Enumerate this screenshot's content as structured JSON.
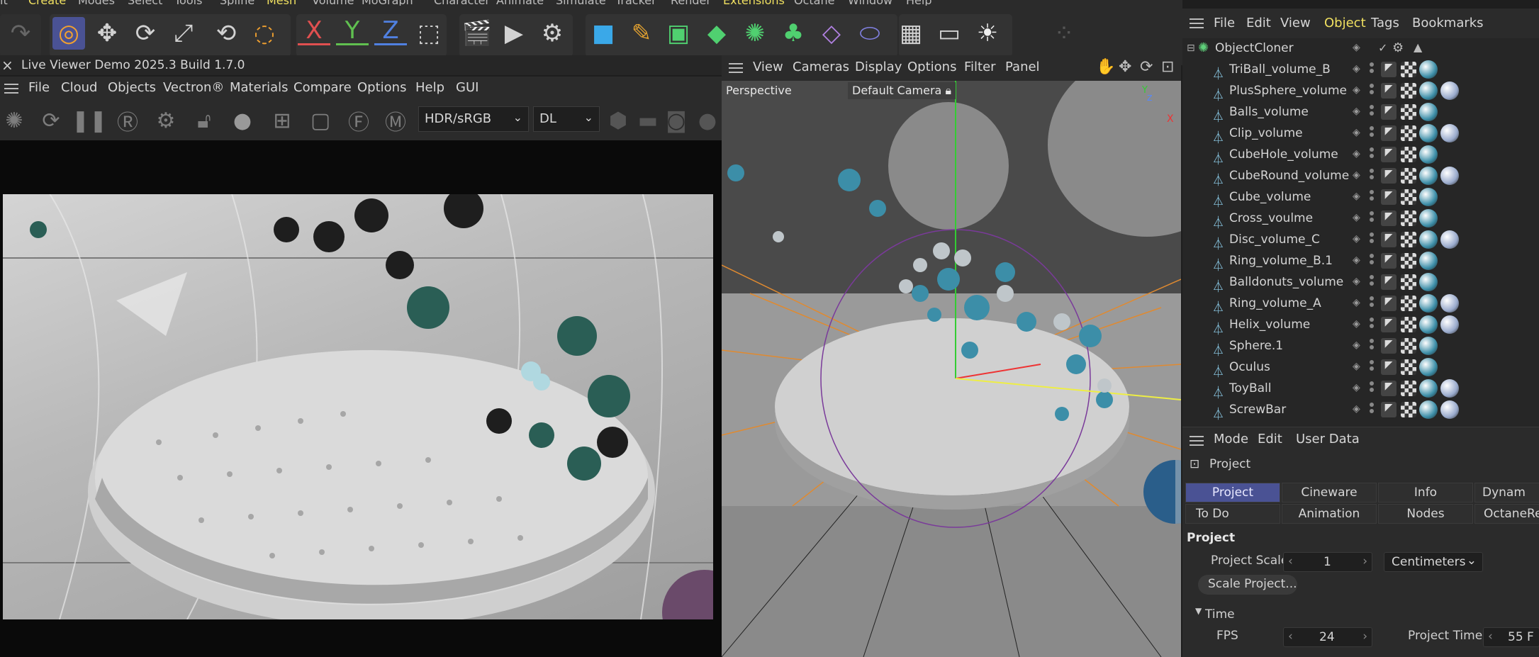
{
  "top_menu": [
    "it",
    "Create",
    "Modes",
    "Select",
    "Tools",
    "Spline",
    "Mesh",
    "Volume",
    "MoGraph",
    "Character",
    "Animate",
    "Simulate",
    "Tracker",
    "Render",
    "Extensions",
    "Octane",
    "Window",
    "Help"
  ],
  "toolbar": {
    "axis_x": "X",
    "axis_y": "Y",
    "axis_z": "Z",
    "icons": [
      "undo-icon",
      "live-selection-icon",
      "move-icon",
      "rotate-icon",
      "scale-icon",
      "last-tool-icon",
      "selection-filter-icon",
      "coordinate-system-icon",
      "clapper-icon",
      "render-view-icon",
      "render-settings-icon",
      "cube-icon",
      "pen-icon",
      "subdivision-icon",
      "extrude-icon",
      "cloner-icon",
      "mograph-icon",
      "deformer-icon",
      "field-icon",
      "grid-icon",
      "camera-icon",
      "light-icon",
      "dots-icon"
    ],
    "accent": "#4a5294"
  },
  "live_viewer": {
    "title": "Live Viewer Demo 2025.3 Build 1.7.0",
    "close_label": "×",
    "menu": [
      "File",
      "Cloud",
      "Objects",
      "Vectron®",
      "Materials",
      "Compare",
      "Options",
      "Help",
      "GUI"
    ],
    "color_space": "HDR/sRGB",
    "kernel": "DL",
    "icons": [
      "octane-icon",
      "restart-icon",
      "pause-icon",
      "region-icon",
      "settings-gear-icon",
      "lock-icon",
      "material-ball-icon",
      "add-icon",
      "frame-icon",
      "focus-icon",
      "marker-icon",
      "cube-small-icon",
      "flat-icon",
      "snapshot-icon",
      "sphere-small-icon"
    ]
  },
  "viewport": {
    "menu": [
      "View",
      "Cameras",
      "Display",
      "Options",
      "Filter",
      "Panel"
    ],
    "projection": "Perspective",
    "camera": "Default Camera",
    "axis_x": "X",
    "axis_y": "Y",
    "axis_z": "Z"
  },
  "object_manager": {
    "menu": [
      "File",
      "Edit",
      "View",
      "Object",
      "Tags",
      "Bookmarks"
    ],
    "active_menu": "Object",
    "root": "ObjectCloner",
    "items": [
      {
        "name": "TriBall_volume_B",
        "balls": 1
      },
      {
        "name": "PlusSphere_volume",
        "balls": 2
      },
      {
        "name": "Balls_volume",
        "balls": 1
      },
      {
        "name": "Clip_volume",
        "balls": 2
      },
      {
        "name": "CubeHole_volume",
        "balls": 1
      },
      {
        "name": "CubeRound_volume",
        "balls": 2
      },
      {
        "name": "Cube_volume",
        "balls": 1
      },
      {
        "name": "Cross_voulme",
        "balls": 1
      },
      {
        "name": "Disc_volume_C",
        "balls": 2
      },
      {
        "name": "Ring_volume_B.1",
        "balls": 1
      },
      {
        "name": "Balldonuts_volume",
        "balls": 1
      },
      {
        "name": "Ring_volume_A",
        "balls": 2
      },
      {
        "name": "Helix_volume",
        "balls": 2
      },
      {
        "name": "Sphere.1",
        "balls": 1
      },
      {
        "name": "Oculus",
        "balls": 1
      },
      {
        "name": "ToyBall",
        "balls": 2
      },
      {
        "name": "ScrewBar",
        "balls": 2
      }
    ]
  },
  "attributes": {
    "menu": [
      "Mode",
      "Edit",
      "User Data"
    ],
    "header": "Project",
    "tabs_row1": [
      "Project",
      "Cineware",
      "Info",
      "Dynam"
    ],
    "tabs_row2": [
      "To Do",
      "Animation",
      "Nodes",
      "OctaneRe"
    ],
    "section": "Project",
    "project_scale_label": "Project Scale",
    "project_scale_value": "1",
    "unit": "Centimeters",
    "scale_button": "Scale Project...",
    "time_section": "Time",
    "fps_label": "FPS",
    "fps_value": "24",
    "project_time_label": "Project Time",
    "project_time_value": "55 F"
  }
}
